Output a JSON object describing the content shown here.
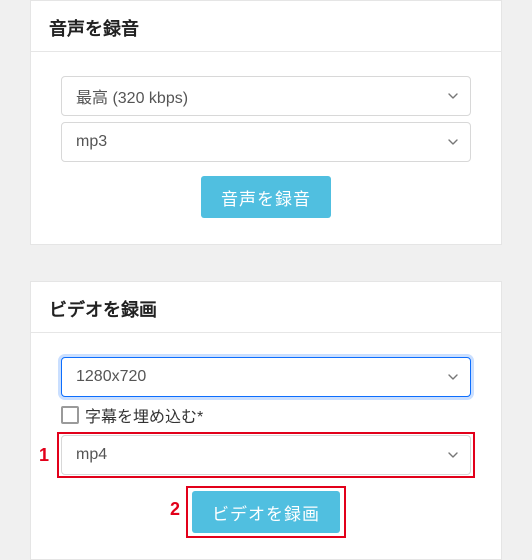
{
  "audio": {
    "title": "音声を録音",
    "quality_selected": "最高 (320 kbps)",
    "format_selected": "mp3",
    "button_label": "音声を録音"
  },
  "video": {
    "title": "ビデオを録画",
    "resolution_selected": "1280x720",
    "embed_subtitles_label": "字幕を埋め込む*",
    "format_selected": "mp4",
    "button_label": "ビデオを録画"
  },
  "annotations": {
    "one": "1",
    "two": "2"
  }
}
